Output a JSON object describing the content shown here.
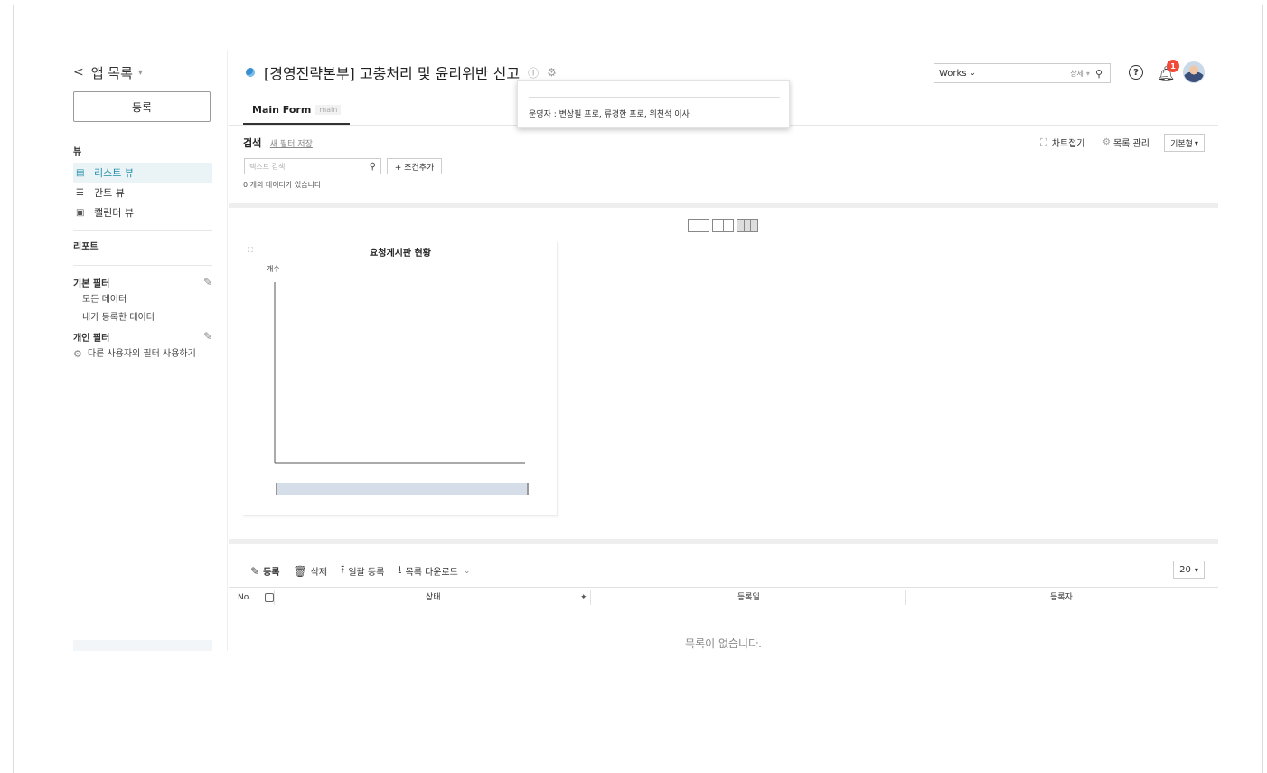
{
  "sidebar": {
    "app_list": "앱 목록",
    "register": "등록",
    "view_section": "뷰",
    "views": [
      {
        "label": "리스트 뷰",
        "icon": "list-icon"
      },
      {
        "label": "간트 뷰",
        "icon": "gantt-icon"
      },
      {
        "label": "캘린더 뷰",
        "icon": "calendar-icon"
      }
    ],
    "report": "리포트",
    "basic_filter": "기본 필터",
    "basic_filters": [
      "모든 데이터",
      "내가 등록한 데이터"
    ],
    "personal_filter": "개인 필터",
    "other_user_filter": "다른 사용자의 필터 사용하기"
  },
  "header": {
    "title": "[경영전략본부] 고충처리 및 윤리위반 신고",
    "tab": "Main Form",
    "tab_tag": "main",
    "tooltip": "운영자 : 변상필 프로, 류경한 프로, 위천석 이사"
  },
  "topbar": {
    "works_select": "Works",
    "search_detail": "상세",
    "notification_count": "1"
  },
  "search": {
    "label": "검색",
    "save_filter": "새 필터 저장",
    "placeholder": "텍스트 검색",
    "add_condition": "+ 조건추가",
    "count_text": "0 개의 데이터가 있습니다"
  },
  "toolbar_right": {
    "chart_fold": "차트접기",
    "list_manage": "목록 관리",
    "layout_select": "기본형"
  },
  "chart": {
    "title": "요청게시판 현황",
    "ylabel": "개수"
  },
  "chart_data": {
    "type": "bar",
    "title": "요청게시판 현황",
    "ylabel": "개수",
    "xlabel": "",
    "categories": [],
    "values": []
  },
  "list": {
    "register": "등록",
    "delete": "삭제",
    "bulk_register": "일괄 등록",
    "download": "목록 다운로드",
    "page_size": "20",
    "columns": [
      "No.",
      "상태",
      "등록일",
      "등록자"
    ],
    "empty": "목록이 없습니다."
  },
  "colors": {
    "accent": "#1f8aa5",
    "active_bg": "#eaf4f7",
    "badge": "#f04a3a",
    "scrollbar": "#d5dde8"
  }
}
